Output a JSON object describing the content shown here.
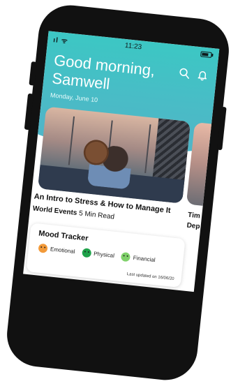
{
  "status_bar": {
    "left": "ıl ᯤ",
    "time": "11:23"
  },
  "header": {
    "greeting": "Good morning, Samwell",
    "date": "Monday, June 10",
    "icons": [
      "search-icon",
      "bell-icon"
    ]
  },
  "articles": [
    {
      "title": "An Intro to Stress & How to Manage It",
      "category": "World Events",
      "duration": "5 Min Read"
    },
    {
      "title_partial_line1": "Tim",
      "title_partial_line2": "Dep"
    }
  ],
  "mood_tracker": {
    "title": "Mood Tracker",
    "items": [
      {
        "label": "Emotional",
        "color": "#f29a3a"
      },
      {
        "label": "Physical",
        "color": "#1fa24a"
      },
      {
        "label": "Financial",
        "color": "#7fd16a"
      }
    ],
    "last_updated": "Last updated on 16/06/20"
  },
  "colors": {
    "accent": "#4fb6c7",
    "phone_body": "#111111"
  }
}
